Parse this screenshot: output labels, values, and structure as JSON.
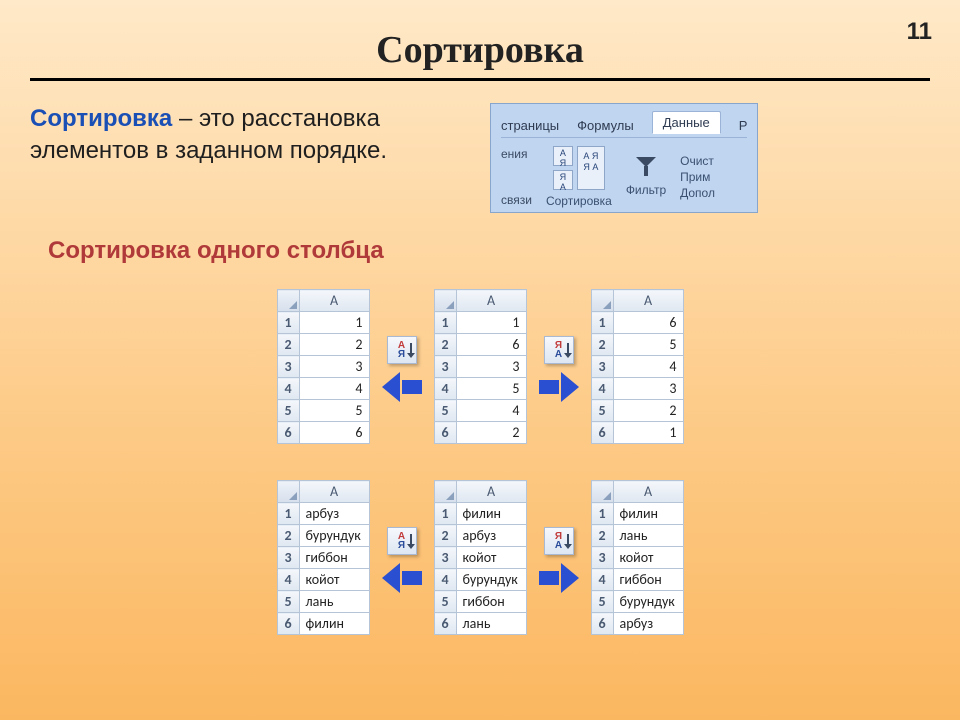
{
  "page_number": "11",
  "title": "Сортировка",
  "definition": {
    "term": "Сортировка",
    "rest": " – это расстановка элементов в заданном порядке."
  },
  "subtitle": "Сортировка одного столбца",
  "ribbon": {
    "tabs": {
      "t0": "страницы",
      "t1": "Формулы",
      "t2": "Данные",
      "t3": "Р"
    },
    "left_col": {
      "l0": "ения",
      "l1": "связи"
    },
    "group_sort_label": "Сортировка",
    "group_filter_label": "Фильтр",
    "side": {
      "s0": "Очист",
      "s1": "Прим",
      "s2": "Допол"
    }
  },
  "sort_icons": {
    "asc_top": "А",
    "asc_bot": "Я",
    "desc_top": "Я",
    "desc_bot": "А"
  },
  "col_header": "A",
  "rows": [
    "1",
    "2",
    "3",
    "4",
    "5",
    "6"
  ],
  "example1": {
    "left": [
      "1",
      "2",
      "3",
      "4",
      "5",
      "6"
    ],
    "center": [
      "1",
      "6",
      "3",
      "5",
      "4",
      "2"
    ],
    "right": [
      "6",
      "5",
      "4",
      "3",
      "2",
      "1"
    ]
  },
  "example2": {
    "left": [
      "арбуз",
      "бурундук",
      "гиббон",
      "койот",
      "лань",
      "филин"
    ],
    "center": [
      "филин",
      "арбуз",
      "койот",
      "бурундук",
      "гиббон",
      "лань"
    ],
    "right": [
      "филин",
      "лань",
      "койот",
      "гиббон",
      "бурундук",
      "арбуз"
    ]
  }
}
